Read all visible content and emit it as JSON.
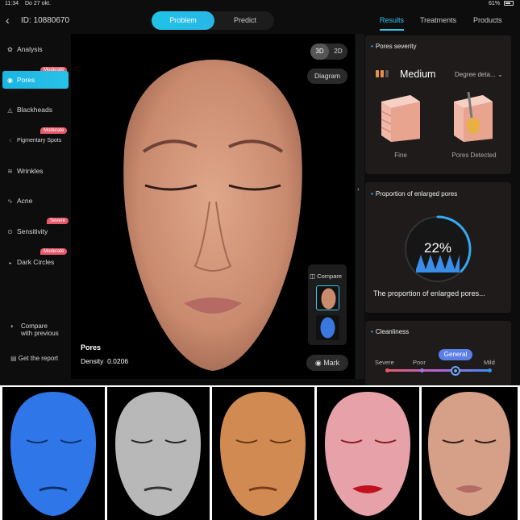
{
  "status": {
    "time": "11:34",
    "date": "Do 27 okt.",
    "battery": "61%"
  },
  "header": {
    "patient_id": "ID: 10880670",
    "tabs": [
      "Problem",
      "Predict"
    ],
    "right_tabs": [
      "Results",
      "Treatments",
      "Products"
    ]
  },
  "sidebar": {
    "items": [
      {
        "label": "Analysis",
        "icon": "analysis-icon",
        "badge": ""
      },
      {
        "label": "Pores",
        "icon": "pores-icon",
        "badge": "Moderate"
      },
      {
        "label": "Blackheads",
        "icon": "blackheads-icon",
        "badge": ""
      },
      {
        "label": "Pigmentary Spots",
        "icon": "spots-icon",
        "badge": "Moderate"
      },
      {
        "label": "Wrinkles",
        "icon": "wrinkles-icon",
        "badge": ""
      },
      {
        "label": "Acne",
        "icon": "acne-icon",
        "badge": ""
      },
      {
        "label": "Sensitivity",
        "icon": "sensitivity-icon",
        "badge": "Severe"
      },
      {
        "label": "Dark Circles",
        "icon": "dark-circles-icon",
        "badge": "Moderate"
      }
    ],
    "compare_line1": "Compare",
    "compare_line2": "with previous",
    "report": "Get the report"
  },
  "viewer": {
    "mode_3d": "3D",
    "mode_2d": "2D",
    "diagram": "Diagram",
    "compare": "Compare",
    "mark": "Mark",
    "feature": "Pores",
    "density_label": "Density",
    "density_value": "0.0206"
  },
  "results": {
    "severity": {
      "title": "Pores severity",
      "level": "Medium",
      "degree": "Degree deta...",
      "images": [
        "Fine",
        "Pores Detected"
      ],
      "level_fraction": 0.67
    },
    "proportion": {
      "title": "Proportion of enlarged pores",
      "value": "22%",
      "text": "The proportion of enlarged pores...",
      "fraction": 0.22
    },
    "cleanliness": {
      "title": "Cleanliness",
      "labels": [
        "Severe",
        "Poor",
        "General",
        "Mild"
      ],
      "selected": "General"
    }
  },
  "filters": [
    "blue-uv",
    "grayscale",
    "brown-spots",
    "red-sensitivity",
    "natural"
  ],
  "colors": {
    "accent": "#36c6f0",
    "badge": "#e85a6b",
    "background": "#0d0d0d",
    "card": "#1e1b1a"
  }
}
